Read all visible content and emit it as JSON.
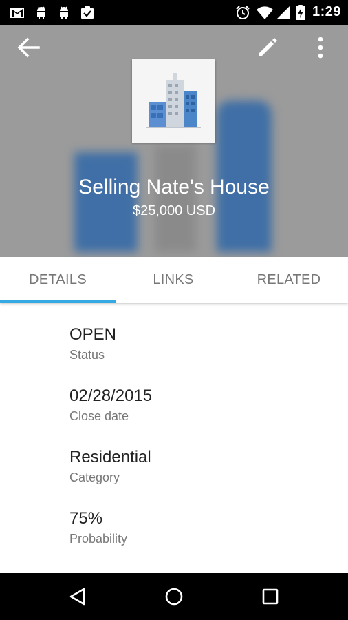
{
  "status_bar": {
    "time": "1:29",
    "icons": [
      "gmail-icon",
      "android-icon",
      "android-icon",
      "clipboard-check-icon",
      "alarm-icon",
      "wifi-icon",
      "signal-icon",
      "battery-charging-icon"
    ]
  },
  "header": {
    "title": "Selling Nate's House",
    "subtitle": "$25,000 USD",
    "actions": [
      "back-arrow-icon",
      "edit-pencil-icon",
      "overflow-menu-icon"
    ]
  },
  "tabs": [
    {
      "label": "DETAILS",
      "selected": true
    },
    {
      "label": "LINKS",
      "selected": false
    },
    {
      "label": "RELATED",
      "selected": false
    }
  ],
  "details": [
    {
      "value": "OPEN",
      "label": "Status"
    },
    {
      "value": "02/28/2015",
      "label": "Close date"
    },
    {
      "value": "Residential",
      "label": "Category"
    },
    {
      "value": "75%",
      "label": "Probability"
    }
  ],
  "colors": {
    "accent": "#35a9e1",
    "header_bg": "#9b9b9b",
    "building_blue": "#4a86c8"
  },
  "nav_bar": [
    "back-triangle-icon",
    "home-circle-icon",
    "recents-square-icon"
  ]
}
